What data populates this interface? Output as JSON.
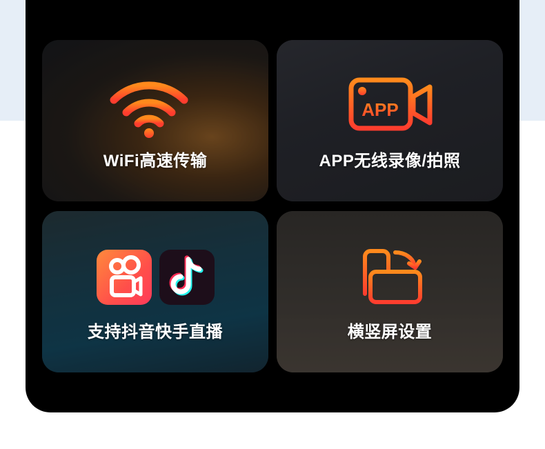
{
  "colors": {
    "accent_orange": "#ff6a1a",
    "accent_red": "#ff3d2e",
    "panel_bg": "#000000",
    "page_top": "#e6eef7"
  },
  "cards": [
    {
      "label": "WiFi高速传输",
      "icon": "wifi-icon"
    },
    {
      "label": "APP无线录像/拍照",
      "icon": "video-camera-icon",
      "icon_text": "APP"
    },
    {
      "label": "支持抖音快手直播",
      "icons": [
        "kuaishou-icon",
        "douyin-icon"
      ]
    },
    {
      "label": "横竖屏设置",
      "icon": "rotate-screen-icon"
    }
  ]
}
